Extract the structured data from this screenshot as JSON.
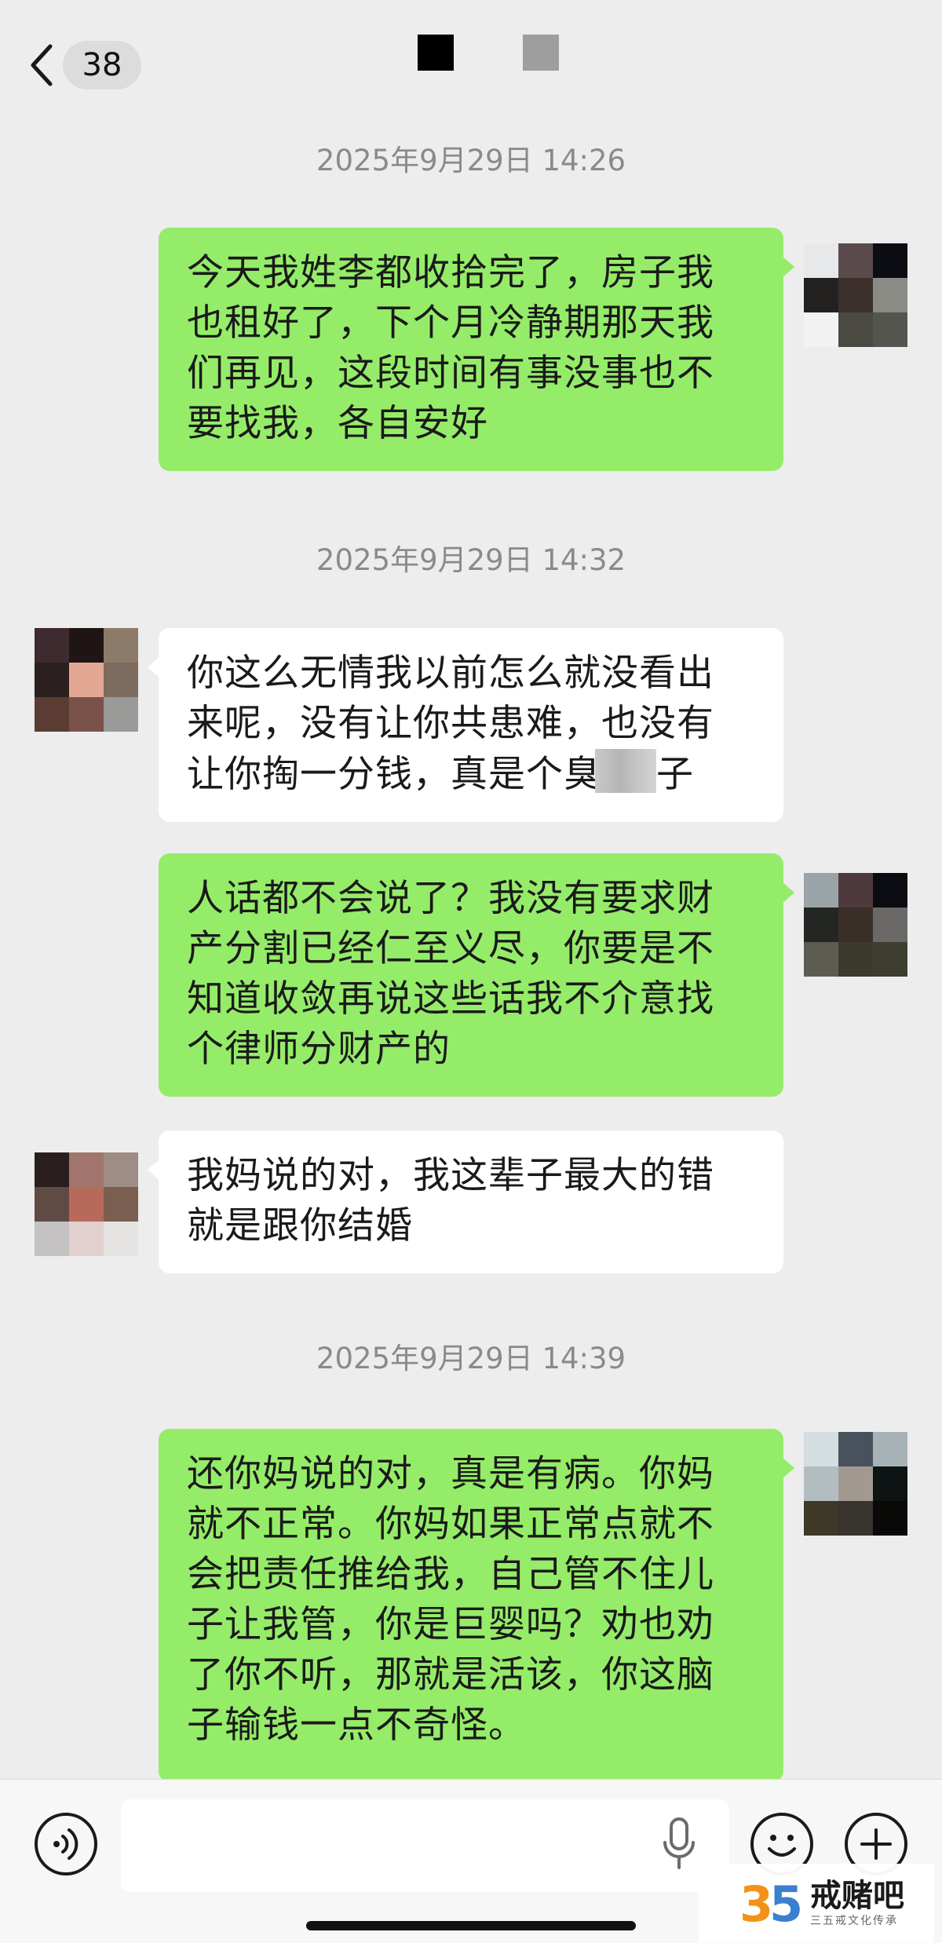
{
  "header": {
    "back_label": "<",
    "unread_count": "38",
    "title_masked": "■ ■"
  },
  "messages": [
    {
      "type": "timestamp",
      "text": "2025年9月29日 14:26"
    },
    {
      "type": "bubble",
      "direction": "out",
      "lines": [
        "今天我姓李都收拾完了，房子我",
        "也租好了，下个月冷静期那天我",
        "们再见，这段时间有事没事也不",
        "要找我，各自安好"
      ]
    },
    {
      "type": "timestamp",
      "text": "2025年9月29日 14:32"
    },
    {
      "type": "bubble",
      "direction": "in",
      "lines": [
        "你这么无情我以前怎么就没看出",
        "来呢，没有让你共患难，也没有",
        "让你掏一分钱，真是个臭",
        "子"
      ]
    },
    {
      "type": "bubble",
      "direction": "out",
      "lines": [
        "人话都不会说了？我没有要求财",
        "产分割已经仁至义尽，你要是不",
        "知道收敛再说这些话我不介意找",
        "个律师分财产的"
      ]
    },
    {
      "type": "bubble",
      "direction": "in",
      "lines": [
        "我妈说的对，我这辈子最大的错",
        "就是跟你结婚"
      ]
    },
    {
      "type": "timestamp",
      "text": "2025年9月29日 14:39"
    },
    {
      "type": "bubble",
      "direction": "out",
      "lines": [
        "还你妈说的对，真是有病。你妈",
        "就不正常。你妈如果正常点就不",
        "会把责任推给我，自己管不住儿",
        "子让我管，你是巨婴吗？劝也劝",
        "了你不听，那就是活该，你这脑",
        "子输钱一点不奇怪。"
      ]
    }
  ],
  "input_bar": {
    "voice_icon": "voice-wave-icon",
    "placeholder": "",
    "mic_icon": "microphone-icon",
    "emoji_icon": "smiley-icon",
    "plus_icon": "plus-icon"
  },
  "watermark": {
    "number": "35",
    "name": "戒赌吧",
    "slogan": "三五戒文化传承"
  },
  "colors": {
    "background": "#ededed",
    "outgoing_bubble": "#95ec69",
    "incoming_bubble": "#ffffff",
    "timestamp_text": "#8a8a8a",
    "avatar_self": [
      "#e6e8ea",
      "#5b4a4c",
      "#0b0d12",
      "#23211f",
      "#3b302c",
      "#8b8b86",
      "#f2f2f2",
      "#4a4a42",
      "#555550"
    ],
    "avatar_other_1": [
      "#3e2b2f",
      "#1f1514",
      "#8d7b6a",
      "#2b1f20",
      "#e3a894",
      "#7e6b5f",
      "#5a3c33",
      "#7a5249",
      "#9a9a98"
    ],
    "avatar_other_2": [
      "#2a1f1e",
      "#a2756e",
      "#9d8d84",
      "#5f4a44",
      "#b76a5b",
      "#7a5f50",
      "#c4c2c3",
      "#e1d0cd",
      "#e6e4e2"
    ],
    "avatar_self_2": [
      "#9aa4a8",
      "#4e3a3c",
      "#0a0c12",
      "#242623",
      "#3b2f2a",
      "#6a6968",
      "#5d5c52",
      "#3b3b2d",
      "#3d3e2e"
    ],
    "avatar_self_3": [
      "#d4dde0",
      "#47525c",
      "#a7b2b6",
      "#b3bdc0",
      "#a29a91",
      "#0e1414",
      "#3e3927",
      "#37342e",
      "#090907"
    ],
    "watermark_orange": "#f29219",
    "watermark_blue": "#3b7fcf"
  }
}
